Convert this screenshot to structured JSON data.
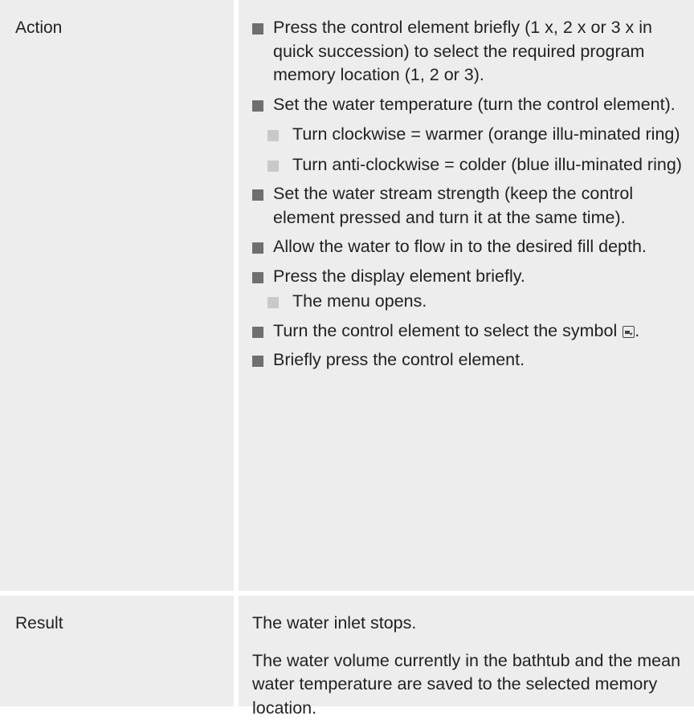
{
  "rows": [
    {
      "label": "Action",
      "items": [
        {
          "level": 1,
          "text": "Press the control element briefly (1 x, 2 x or 3 x in quick succession) to select the required program memory location (1, 2 or 3)."
        },
        {
          "level": 1,
          "text": "Set the water temperature (turn the control element)."
        },
        {
          "level": 2,
          "text": "Turn clockwise = warmer (orange illu-minated ring)"
        },
        {
          "level": 2,
          "text": "Turn anti-clockwise = colder (blue illu-minated ring)"
        },
        {
          "level": 1,
          "text": "Set the water stream strength (keep the control element pressed and turn it at the same time)."
        },
        {
          "level": 1,
          "text": "Allow the water to flow in to the desired fill depth."
        },
        {
          "level": 1,
          "text": "Press the display element briefly."
        },
        {
          "level": 2,
          "text": "The menu opens."
        },
        {
          "level": 1,
          "text": "Turn the control element to select the symbol",
          "trailing_text": ".",
          "icon": "save-to-memory-icon"
        },
        {
          "level": 1,
          "text": "Briefly press the control element."
        }
      ]
    },
    {
      "label": "Result",
      "paragraphs": [
        "The water inlet stops.",
        "The water volume currently in the bathtub and the mean water temperature are saved to the selected memory location."
      ]
    }
  ],
  "colors": {
    "cell_background": "#ededed",
    "separator": "#ffffff",
    "bullet_primary": "#6f6f6f",
    "bullet_secondary": "#c9c9c9",
    "text": "#222222"
  }
}
